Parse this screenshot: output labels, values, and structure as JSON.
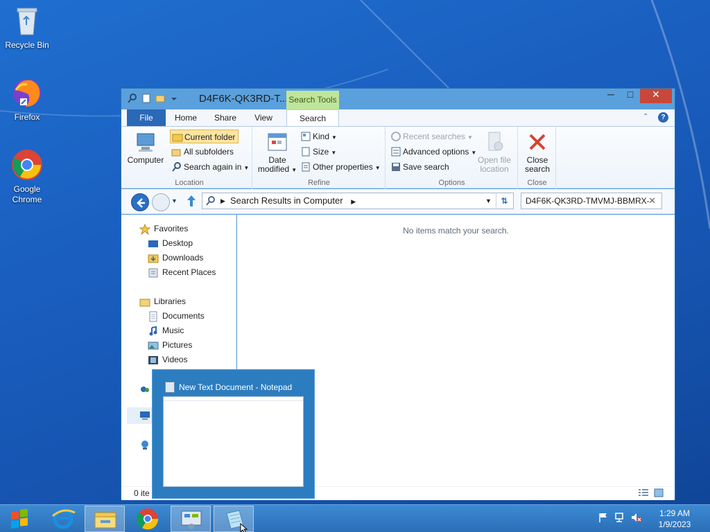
{
  "desktop": {
    "icons": [
      {
        "label": "Recycle Bin"
      },
      {
        "label": "Firefox"
      },
      {
        "label": "Google Chrome"
      }
    ]
  },
  "explorer": {
    "title": "D4F6K-QK3RD-T...",
    "context_tab": "Search Tools",
    "tabs": {
      "file": "File",
      "home": "Home",
      "share": "Share",
      "view": "View",
      "search": "Search"
    },
    "ribbon": {
      "location": {
        "computer": "Computer",
        "current_folder": "Current folder",
        "all_subfolders": "All subfolders",
        "search_again_in": "Search again in",
        "group": "Location"
      },
      "refine": {
        "date_modified_1": "Date",
        "date_modified_2": "modified",
        "kind": "Kind",
        "size": "Size",
        "other_properties": "Other properties",
        "group": "Refine"
      },
      "options": {
        "recent_searches": "Recent searches",
        "advanced_options": "Advanced options",
        "save_search": "Save search",
        "open_file_location_1": "Open file",
        "open_file_location_2": "location",
        "group": "Options"
      },
      "close": {
        "close_search_1": "Close",
        "close_search_2": "search",
        "group": "Close"
      }
    },
    "address": {
      "path": "Search Results in Computer"
    },
    "search": {
      "query": "D4F6K-QK3RD-TMVMJ-BBMRX-"
    },
    "nav": {
      "favorites": "Favorites",
      "desktop": "Desktop",
      "downloads": "Downloads",
      "recent_places": "Recent Places",
      "libraries": "Libraries",
      "documents": "Documents",
      "music": "Music",
      "pictures": "Pictures",
      "videos": "Videos"
    },
    "empty_message": "No items match your search.",
    "status": {
      "count": "0 ite"
    }
  },
  "thumbnail": {
    "title": "New Text Document - Notepad"
  },
  "taskbar": {
    "time": "1:29 AM",
    "date": "1/9/2023"
  },
  "colors": {
    "accent": "#2a68b8",
    "close": "#c7483a",
    "context_tab": "#bfe59a"
  }
}
